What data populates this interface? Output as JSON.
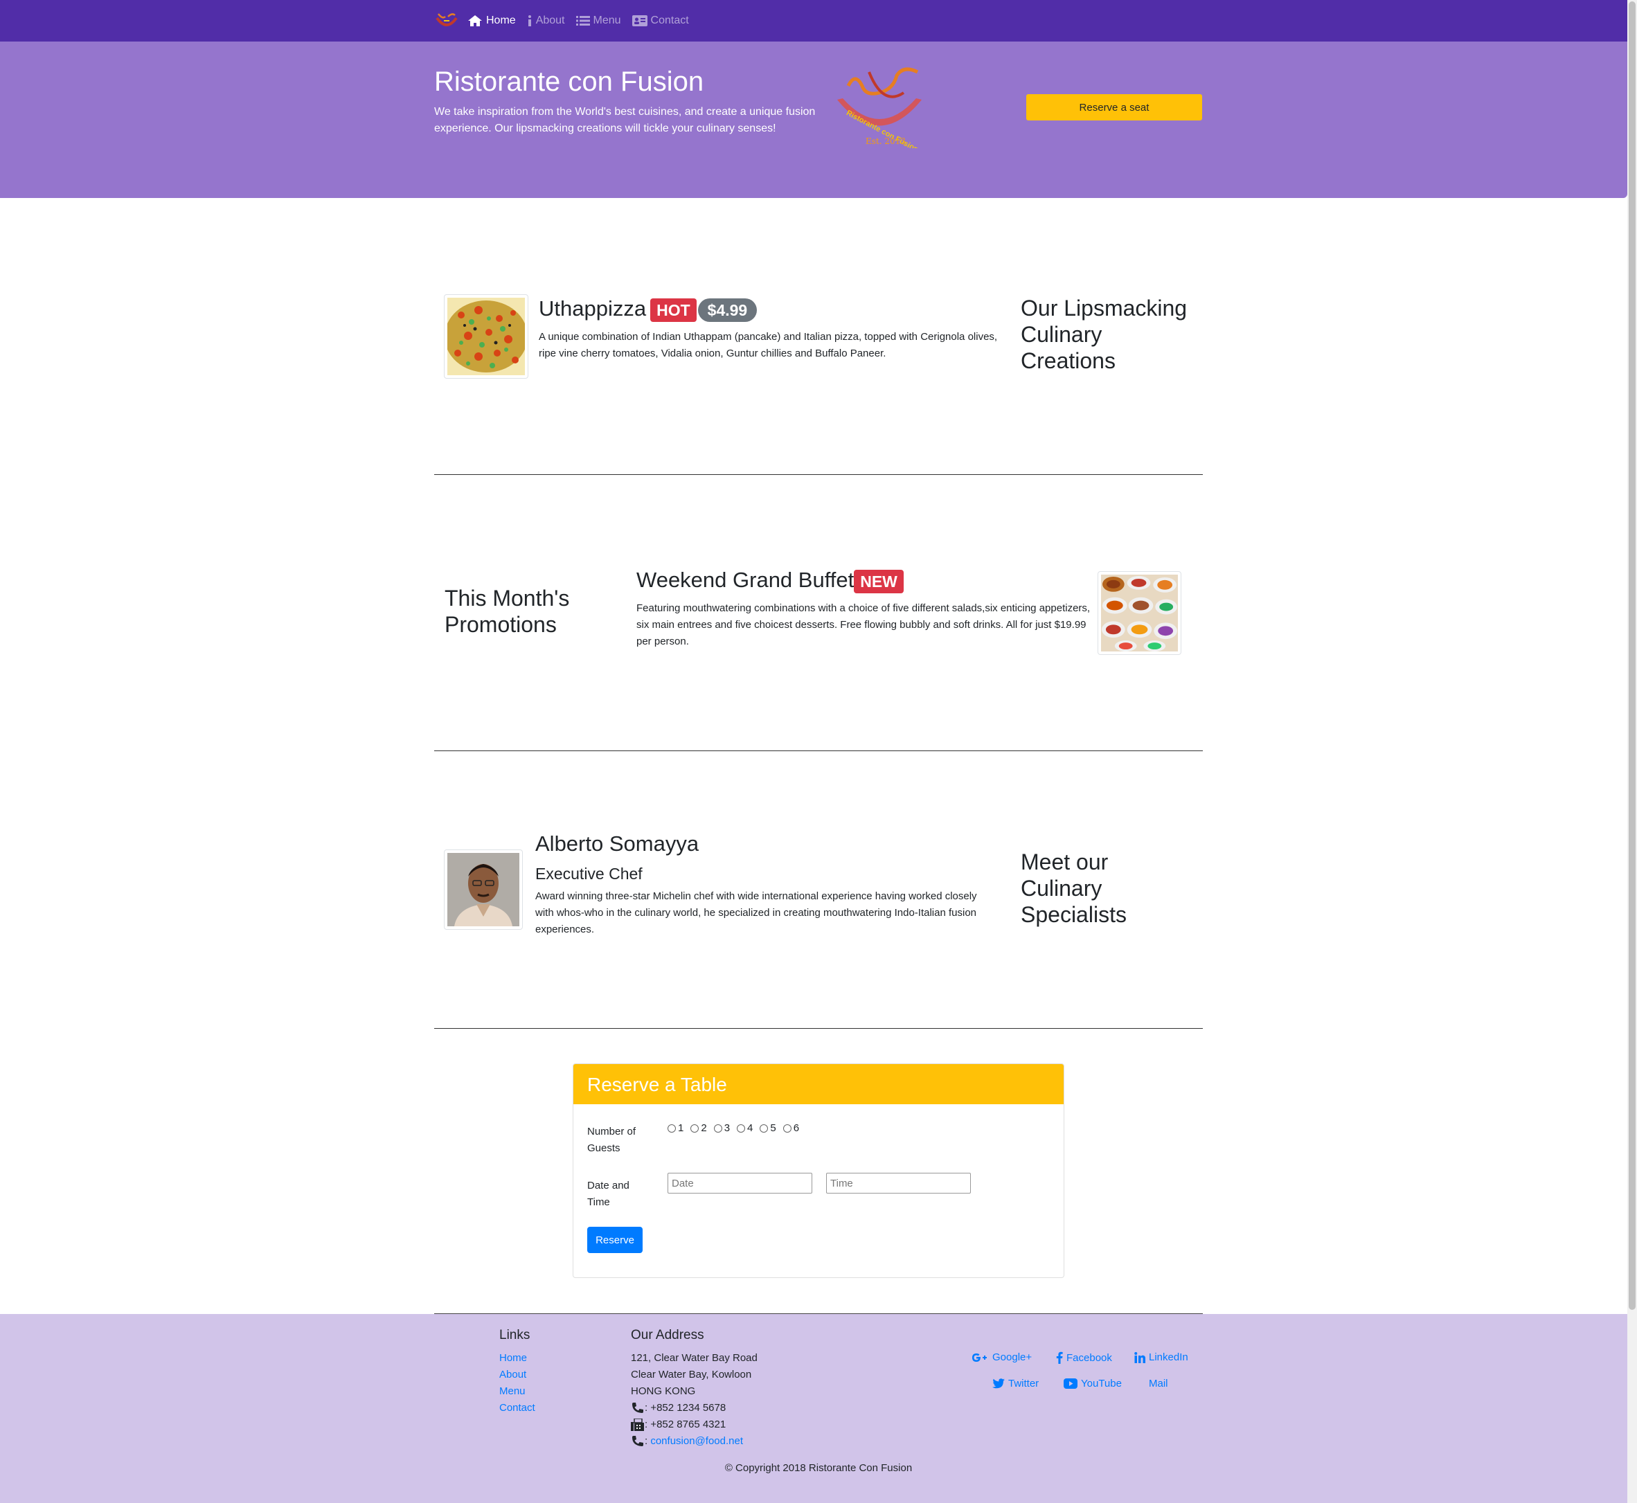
{
  "nav": {
    "items": [
      {
        "label": "Home",
        "icon": "home-icon",
        "active": true
      },
      {
        "label": "About",
        "icon": "info-icon",
        "active": false
      },
      {
        "label": "Menu",
        "icon": "list-icon",
        "active": false
      },
      {
        "label": "Contact",
        "icon": "address-card-icon",
        "active": false
      }
    ]
  },
  "jumbotron": {
    "title": "Ristorante con Fusion",
    "text": "We take inspiration from the World's best cuisines, and create a unique fusion experience. Our lipsmacking creations will tickle your culinary senses!",
    "logo_text": "Ristorante con Fusion",
    "logo_est": "Est. 2013",
    "reserve_button": "Reserve a seat"
  },
  "dish": {
    "name": "Uthappizza",
    "badge_hot": "HOT",
    "price": "$4.99",
    "description": "A unique combination of Indian Uthappam (pancake) and Italian pizza, topped with Cerignola olives, ripe vine cherry tomatoes, Vidalia onion, Guntur chillies and Buffalo Paneer.",
    "section_heading": "Our Lipsmacking Culinary Creations"
  },
  "promotion": {
    "section_heading": "This Month's Promotions",
    "name": "Weekend Grand Buffet",
    "badge_new": "NEW",
    "description": "Featuring mouthwatering combinations with a choice of five different salads,six enticing appetizers, six main entrees and five choicest desserts. Free flowing bubbly and soft drinks. All for just $19.99 per person."
  },
  "leader": {
    "name": "Alberto Somayya",
    "designation": "Executive Chef",
    "description": "Award winning three-star Michelin chef with wide international experience having worked closely with whos-who in the culinary world, he specialized in creating mouthwatering Indo-Italian fusion experiences.",
    "section_heading": "Meet our Culinary Specialists"
  },
  "reserve": {
    "title": "Reserve a Table",
    "guests_label": "Number of Guests",
    "guest_options": [
      "1",
      "2",
      "3",
      "4",
      "5",
      "6"
    ],
    "datetime_label": "Date and Time",
    "date_placeholder": "Date",
    "time_placeholder": "Time",
    "submit": "Reserve"
  },
  "footer": {
    "links_heading": "Links",
    "links": [
      "Home",
      "About",
      "Menu",
      "Contact"
    ],
    "address_heading": "Our Address",
    "address_lines": [
      "121, Clear Water Bay Road",
      "Clear Water Bay, Kowloon",
      "HONG KONG"
    ],
    "phone": ": +852 1234 5678",
    "fax": ": +852 8765 4321",
    "email_prefix": ": ",
    "email": "confusion@food.net",
    "social": {
      "google": "Google+",
      "facebook": "Facebook",
      "linkedin": "LinkedIn",
      "twitter": "Twitter",
      "youtube": "YouTube",
      "mail": "Mail"
    },
    "copyright": "© Copyright 2018 Ristorante Con Fusion"
  },
  "colors": {
    "navbar": "#512DA8",
    "jumbotron": "#9575CD",
    "footer": "#D1C4E9",
    "accent": "#FFC107",
    "danger": "#dc3545",
    "primary": "#007bff"
  }
}
